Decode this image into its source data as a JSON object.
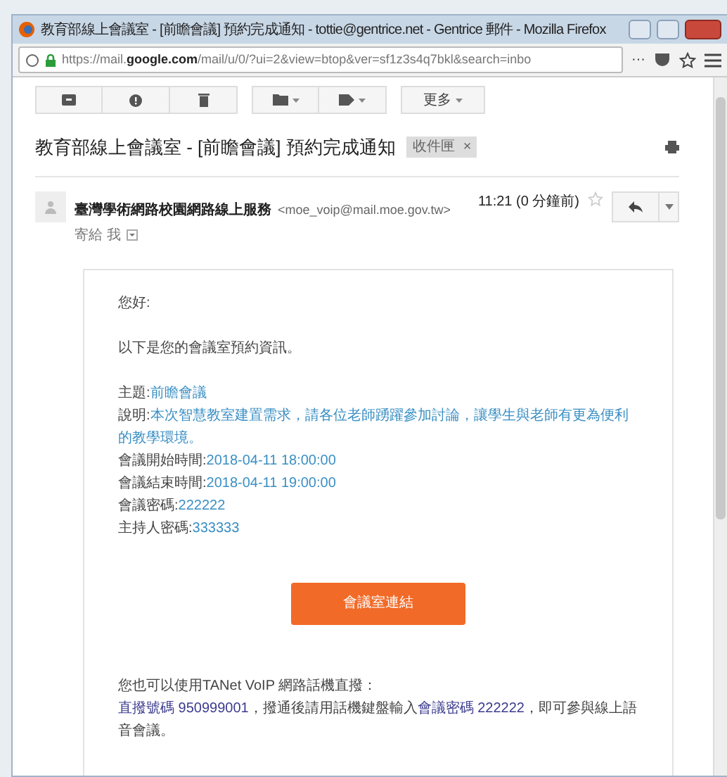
{
  "window": {
    "title": "教育部線上會議室 - [前瞻會議] 預約完成通知 - tottie@gentrice.net - Gentrice 郵件 - Mozilla Firefox"
  },
  "address_bar": {
    "url_host_prefix": "https://mail.",
    "url_host": "google.com",
    "url_rest": "/mail/u/0/?ui=2&view=btop&ver=sf1z3s4q7bkl&search=inbo",
    "more": "···"
  },
  "toolbar": {
    "groups": [
      [
        {
          "kind": "archive"
        },
        {
          "kind": "spam"
        },
        {
          "kind": "delete"
        }
      ],
      [
        {
          "kind": "folder"
        },
        {
          "kind": "label"
        }
      ],
      [
        {
          "kind": "more",
          "label": "更多"
        }
      ]
    ]
  },
  "message": {
    "subject": "教育部線上會議室 - [前瞻會議] 預約完成通知",
    "tag": "收件匣",
    "tag_close": "×",
    "sender_name": "臺灣學術網路校園網路線上服務",
    "sender_email": "<moe_voip@mail.moe.gov.tw>",
    "recipient": "寄給 我",
    "time": "11:21 (0 分鐘前)",
    "starred": false
  },
  "body": {
    "greeting": "您好:",
    "intro": "以下是您的會議室預約資訊。",
    "fields": [
      {
        "label": "主題:",
        "value": "前瞻會議"
      },
      {
        "label": "說明:",
        "value": "本次智慧教室建置需求，請各位老師踴躍參加討論，讓學生與老師有更為便利的教學環境。"
      },
      {
        "label": "會議開始時間:",
        "value": "2018-04-11 18:00:00"
      },
      {
        "label": "會議結束時間:",
        "value": "2018-04-11 19:00:00"
      },
      {
        "label": "會議密碼:",
        "value": "222222"
      },
      {
        "label": "主持人密碼:",
        "value": "333333"
      }
    ],
    "button": "會議室連結",
    "voip_intro": "您也可以使用TANet VoIP 網路話機直撥：",
    "voip_segments": [
      {
        "text": "直撥號碼 950999001",
        "highlight": true
      },
      {
        "text": "，撥通後請用話機鍵盤輸入",
        "highlight": false
      },
      {
        "text": "會議密碼 222222",
        "highlight": true
      },
      {
        "text": "，即可參與線上語音會議。",
        "highlight": false
      }
    ]
  }
}
